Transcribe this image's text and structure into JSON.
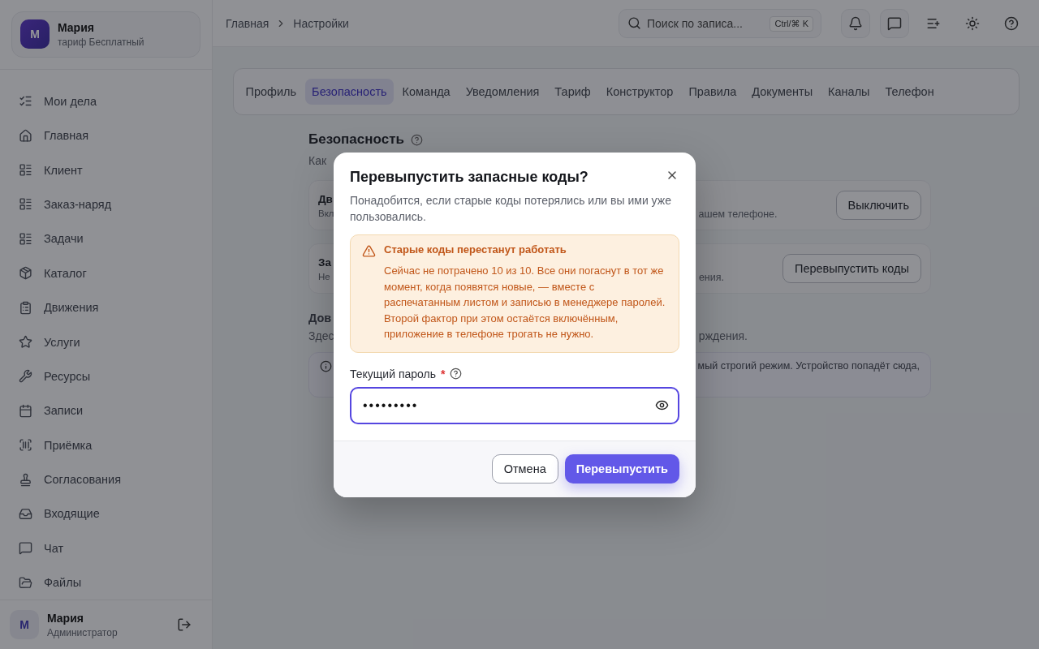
{
  "sidebar": {
    "account": {
      "avatar": "М",
      "name": "Мария",
      "plan": "тариф Бесплатный"
    },
    "items": [
      {
        "label": "Мои дела"
      },
      {
        "label": "Главная"
      },
      {
        "label": "Клиент"
      },
      {
        "label": "Заказ-наряд"
      },
      {
        "label": "Задачи"
      },
      {
        "label": "Каталог"
      },
      {
        "label": "Движения"
      },
      {
        "label": "Услуги"
      },
      {
        "label": "Ресурсы"
      },
      {
        "label": "Записи"
      },
      {
        "label": "Приёмка"
      },
      {
        "label": "Согласования"
      },
      {
        "label": "Входящие"
      },
      {
        "label": "Чат"
      },
      {
        "label": "Файлы"
      }
    ],
    "user": {
      "avatar": "М",
      "name": "Мария",
      "role": "Администратор"
    }
  },
  "header": {
    "breadcrumbs": [
      "Главная",
      "Настройки"
    ],
    "search": {
      "placeholder": "Поиск по записа...",
      "shortcut": "Ctrl/⌘ K"
    }
  },
  "tabs": [
    {
      "label": "Профиль",
      "selected": false
    },
    {
      "label": "Безопасность",
      "selected": true
    },
    {
      "label": "Команда",
      "selected": false
    },
    {
      "label": "Уведомления",
      "selected": false
    },
    {
      "label": "Тариф",
      "selected": false
    },
    {
      "label": "Конструктор",
      "selected": false
    },
    {
      "label": "Правила",
      "selected": false
    },
    {
      "label": "Документы",
      "selected": false
    },
    {
      "label": "Каналы",
      "selected": false
    },
    {
      "label": "Телефон",
      "selected": false
    }
  ],
  "page": {
    "title": "Безопасность",
    "subtitle": "Как",
    "cards": [
      {
        "title": "Дв",
        "text": "Вкл",
        "text_right": "ашем телефоне.",
        "button": "Выключить"
      },
      {
        "title": "За",
        "text": "Не",
        "text_right": "ения.",
        "button": "Перевыпустить коды"
      }
    ],
    "devices": {
      "title": "Дов",
      "text": "Здес",
      "text_right": "рждения.",
      "notice_right": "мый строгий режим. Устройство попадёт сюда,"
    }
  },
  "dialog": {
    "title": "Перевыпустить запасные коды?",
    "description": "Понадобится, если старые коды потерялись или вы ими уже пользовались.",
    "warning": {
      "title": "Старые коды перестанут работать",
      "text": "Сейчас не потрачено 10 из 10. Все они погаснут в тот же момент, когда появятся новые, — вместе с распечатанным листом и записью в менеджере паролей. Второй фактор при этом остаётся включённым, приложение в телефоне трогать не нужно."
    },
    "field": {
      "label": "Текущий пароль",
      "required_mark": "*",
      "value": "•••••••••"
    },
    "buttons": {
      "cancel": "Отмена",
      "confirm": "Перевыпустить"
    }
  }
}
